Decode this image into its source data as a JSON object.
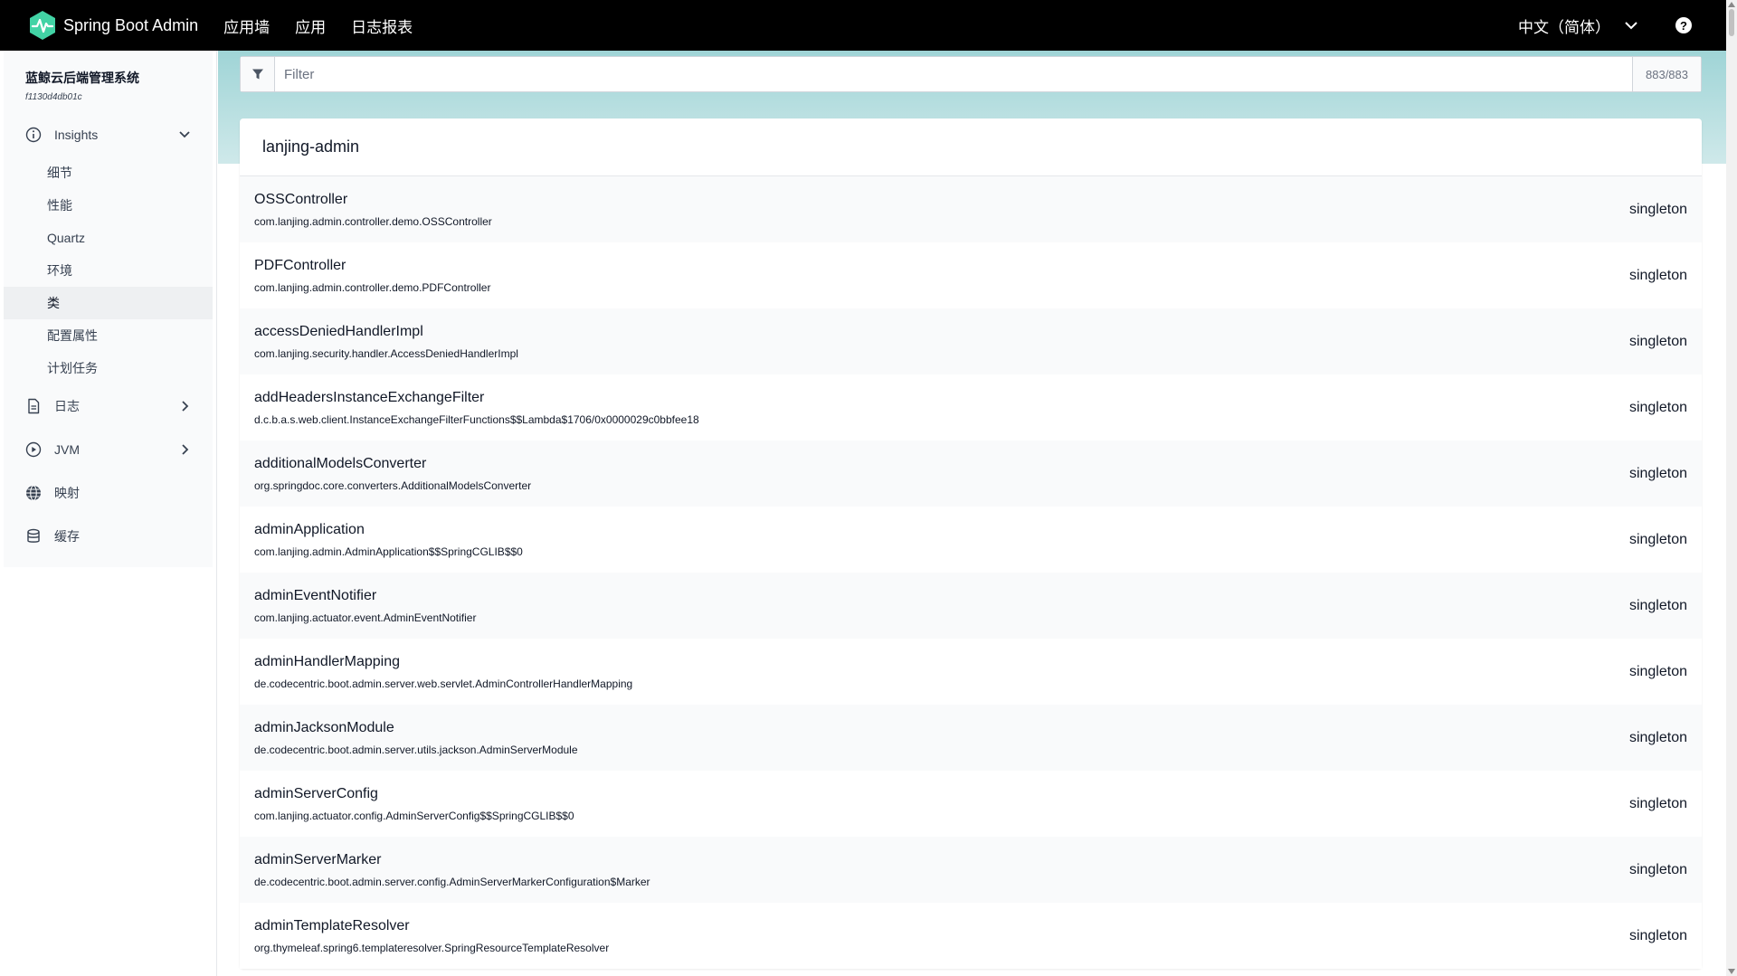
{
  "header": {
    "brand": "Spring Boot Admin",
    "nav": [
      "应用墙",
      "应用",
      "日志报表"
    ],
    "language": "中文（简体）",
    "help_glyph": "?"
  },
  "sidebar": {
    "app_name": "蓝鲸云后端管理系统",
    "app_id": "f1130d4db01c",
    "insights": {
      "label": "Insights",
      "items": [
        "细节",
        "性能",
        "Quartz",
        "环境",
        "类",
        "配置属性",
        "计划任务"
      ],
      "active_index": 4
    },
    "groups": [
      {
        "label": "日志",
        "icon": "document-icon"
      },
      {
        "label": "JVM",
        "icon": "play-circle-icon"
      },
      {
        "label": "映射",
        "icon": "globe-icon"
      },
      {
        "label": "缓存",
        "icon": "database-icon"
      }
    ]
  },
  "filter": {
    "placeholder": "Filter",
    "count": "883/883"
  },
  "card": {
    "title": "lanjing-admin",
    "beans": [
      {
        "name": "OSSController",
        "type": "com.lanjing.admin.controller.demo.OSSController",
        "scope": "singleton"
      },
      {
        "name": "PDFController",
        "type": "com.lanjing.admin.controller.demo.PDFController",
        "scope": "singleton"
      },
      {
        "name": "accessDeniedHandlerImpl",
        "type": "com.lanjing.security.handler.AccessDeniedHandlerImpl",
        "scope": "singleton"
      },
      {
        "name": "addHeadersInstanceExchangeFilter",
        "type": "d.c.b.a.s.web.client.InstanceExchangeFilterFunctions$$Lambda$1706/0x0000029c0bbfee18",
        "scope": "singleton"
      },
      {
        "name": "additionalModelsConverter",
        "type": "org.springdoc.core.converters.AdditionalModelsConverter",
        "scope": "singleton"
      },
      {
        "name": "adminApplication",
        "type": "com.lanjing.admin.AdminApplication$$SpringCGLIB$$0",
        "scope": "singleton"
      },
      {
        "name": "adminEventNotifier",
        "type": "com.lanjing.actuator.event.AdminEventNotifier",
        "scope": "singleton"
      },
      {
        "name": "adminHandlerMapping",
        "type": "de.codecentric.boot.admin.server.web.servlet.AdminControllerHandlerMapping",
        "scope": "singleton"
      },
      {
        "name": "adminJacksonModule",
        "type": "de.codecentric.boot.admin.server.utils.jackson.AdminServerModule",
        "scope": "singleton"
      },
      {
        "name": "adminServerConfig",
        "type": "com.lanjing.actuator.config.AdminServerConfig$$SpringCGLIB$$0",
        "scope": "singleton"
      },
      {
        "name": "adminServerMarker",
        "type": "de.codecentric.boot.admin.server.config.AdminServerMarkerConfiguration$Marker",
        "scope": "singleton"
      },
      {
        "name": "adminTemplateResolver",
        "type": "org.thymeleaf.spring6.templateresolver.SpringResourceTemplateResolver",
        "scope": "singleton"
      }
    ]
  },
  "colors": {
    "topbar": "#000000",
    "logo_accent": "#42d3a5",
    "band": "#a7d7d8"
  }
}
